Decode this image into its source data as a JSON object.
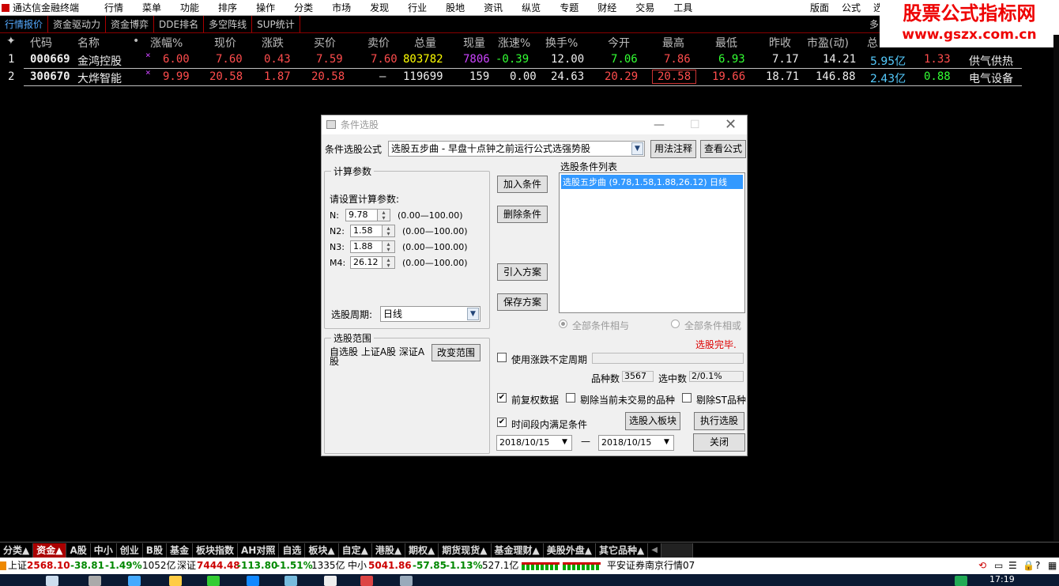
{
  "menubar": {
    "app": "通达信金融终端",
    "items": [
      "行情",
      "菜单",
      "功能",
      "排序",
      "操作",
      "分类",
      "市场",
      "发现",
      "行业",
      "股地",
      "资讯",
      "纵览",
      "专题",
      "财经",
      "交易",
      "工具"
    ],
    "right": [
      "版面",
      "公式",
      "选项"
    ]
  },
  "watermark": {
    "title": "股票公式指标网",
    "url": "www.gszx.com.cn"
  },
  "tabs": [
    "行情报价",
    "资金驱动力",
    "资金博弈",
    "DDE排名",
    "多空阵线",
    "SUP统计"
  ],
  "right_tab": "多",
  "table": {
    "headers": [
      "代码",
      "名称",
      "•",
      "涨幅%",
      "现价",
      "涨跌",
      "买价",
      "卖价",
      "总量",
      "现量",
      "涨速%",
      "换手%",
      "今开",
      "最高",
      "最低",
      "昨收",
      "市盈(动)",
      "总"
    ],
    "rows": [
      {
        "idx": "1",
        "code": "000669",
        "name": "金鸿控股",
        "mark": "×",
        "chg_pct": "6.00",
        "price": "7.60",
        "chg": "0.43",
        "bid": "7.59",
        "ask": "7.60",
        "vol": "803782",
        "cur_vol": "7806",
        "speed": "-0.39",
        "turnover": "12.00",
        "open": "7.06",
        "high": "7.86",
        "low": "6.93",
        "prev": "7.17",
        "pe": "14.21",
        "cap": "5.95亿",
        "x1": "1.33",
        "industry": "供气供热"
      },
      {
        "idx": "2",
        "code": "300670",
        "name": "大烨智能",
        "mark": "×",
        "chg_pct": "9.99",
        "price": "20.58",
        "chg": "1.87",
        "bid": "20.58",
        "ask": "—",
        "vol": "119699",
        "cur_vol": "159",
        "speed": "0.00",
        "turnover": "24.63",
        "open": "20.29",
        "high": "20.58",
        "low": "19.66",
        "prev": "18.71",
        "pe": "146.88",
        "cap": "2.43亿",
        "x1": "0.88",
        "industry": "电气设备"
      }
    ]
  },
  "dialog": {
    "title": "条件选股",
    "formula_label": "条件选股公式",
    "formula_value": "选股五步曲   - 早盘十点钟之前运行公式选强势股",
    "btn_usage": "用法注释",
    "btn_view": "查看公式",
    "calc_group": "计算参数",
    "calc_prompt": "请设置计算参数:",
    "params": [
      {
        "name": "N:",
        "value": "9.78",
        "range": "(0.00—100.00)"
      },
      {
        "name": "N2:",
        "value": "1.58",
        "range": "(0.00—100.00)"
      },
      {
        "name": "N3:",
        "value": "1.88",
        "range": "(0.00—100.00)"
      },
      {
        "name": "M4:",
        "value": "26.12",
        "range": "(0.00—100.00)"
      }
    ],
    "period_label": "选股周期:",
    "period_value": "日线",
    "btn_add": "加入条件",
    "btn_del": "删除条件",
    "btn_import": "引入方案",
    "btn_save": "保存方案",
    "list_label": "选股条件列表",
    "list_item": "选股五步曲 (9.78,1.58,1.88,26.12) 日线",
    "radio_and": "全部条件相与",
    "radio_or": "全部条件相或",
    "done": "选股完毕.",
    "range_group": "选股范围",
    "range_text": "自选股 上证A股 深证A股",
    "btn_range": "改变范围",
    "chk_period": "使用涨跌不定周期",
    "count_label": "品种数",
    "count_value": "3567",
    "sel_label": "选中数",
    "sel_value": "2/0.1%",
    "chk_restore": "前复权数据",
    "chk_exclude": "剔除当前未交易的品种",
    "chk_st": "剔除ST品种",
    "chk_time": "时间段内满足条件",
    "btn_block": "选股入板块",
    "btn_run": "执行选股",
    "date_from": "2018/10/15",
    "date_sep": "—",
    "date_to": "2018/10/15",
    "btn_close": "关闭"
  },
  "bottom_tabs": [
    "分类▲",
    "资金▲",
    "A股",
    "中小",
    "创业",
    "B股",
    "基金",
    "板块指数",
    "AH对照",
    "自选",
    "板块▲",
    "自定▲",
    "港股▲",
    "期权▲",
    "期货现货▲",
    "基金理财▲",
    "美股外盘▲",
    "其它品种▲"
  ],
  "status": {
    "sh_label": "上证",
    "sh_val": "2568.10",
    "sh_chg": "-38.81",
    "sh_pct": "-1.49%",
    "sh_amt": "1052亿",
    "sz_label": "深证",
    "sz_val": "7444.48",
    "sz_chg": "-113.80",
    "sz_pct": "-1.51%",
    "sz_amt": "1335亿",
    "zx_label": "中小",
    "zx_val": "5041.86",
    "zx_chg": "-57.85",
    "zx_pct": "-1.13%",
    "zx_amt": "527.1亿",
    "broker": "平安证券南京行情07"
  },
  "clock": "17:19"
}
